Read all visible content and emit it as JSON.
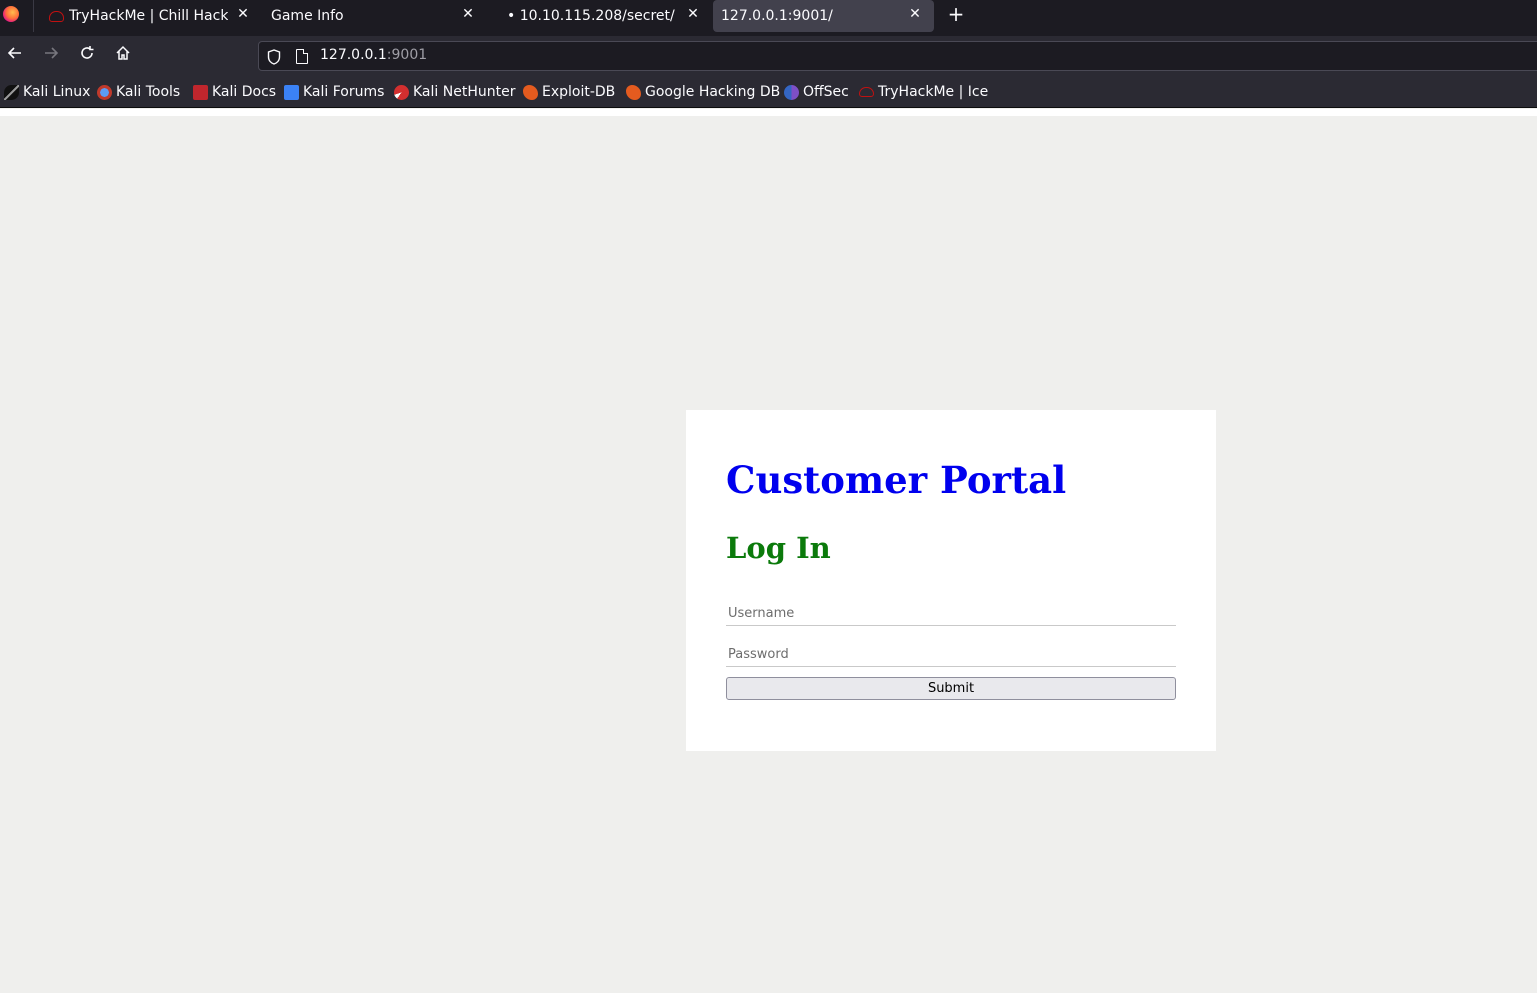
{
  "browser": {
    "tabs": [
      {
        "label": "TryHackMe | Chill Hack",
        "icon": "tryhackme-icon"
      },
      {
        "label": "Game Info",
        "icon": ""
      },
      {
        "label": "• 10.10.115.208/secret/",
        "icon": ""
      },
      {
        "label": "127.0.0.1:9001/",
        "icon": "",
        "active": true
      }
    ],
    "close_glyph": "✕",
    "new_tab_glyph": "+",
    "url": {
      "host": "127.0.0.1",
      "port": ":9001"
    },
    "bookmarks": [
      {
        "label": "Kali Linux",
        "icon": "kali-icon"
      },
      {
        "label": "Kali Tools",
        "icon": "kali-tools-icon"
      },
      {
        "label": "Kali Docs",
        "icon": "kali-docs-icon"
      },
      {
        "label": "Kali Forums",
        "icon": "kali-forums-icon"
      },
      {
        "label": "Kali NetHunter",
        "icon": "nethunter-icon"
      },
      {
        "label": "Exploit-DB",
        "icon": "exploit-db-icon"
      },
      {
        "label": "Google Hacking DB",
        "icon": "exploit-db-icon"
      },
      {
        "label": "OffSec",
        "icon": "offsec-icon"
      },
      {
        "label": "TryHackMe | Ice",
        "icon": "tryhackme-icon"
      }
    ]
  },
  "page": {
    "title": "Customer Portal",
    "subtitle": "Log In",
    "username_placeholder": "Username",
    "password_placeholder": "Password",
    "submit_label": "Submit",
    "title_color": "#0000ee",
    "subtitle_color": "#0b7a0b"
  }
}
